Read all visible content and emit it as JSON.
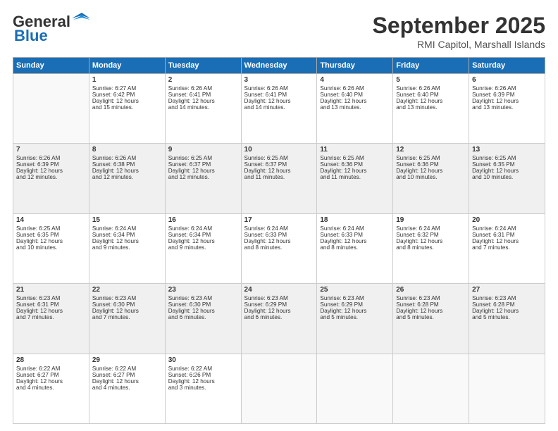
{
  "header": {
    "logo_line1": "General",
    "logo_line2": "Blue",
    "month": "September 2025",
    "location": "RMI Capitol, Marshall Islands"
  },
  "days_of_week": [
    "Sunday",
    "Monday",
    "Tuesday",
    "Wednesday",
    "Thursday",
    "Friday",
    "Saturday"
  ],
  "weeks": [
    [
      {
        "day": "",
        "lines": []
      },
      {
        "day": "1",
        "lines": [
          "Sunrise: 6:27 AM",
          "Sunset: 6:42 PM",
          "Daylight: 12 hours",
          "and 15 minutes."
        ]
      },
      {
        "day": "2",
        "lines": [
          "Sunrise: 6:26 AM",
          "Sunset: 6:41 PM",
          "Daylight: 12 hours",
          "and 14 minutes."
        ]
      },
      {
        "day": "3",
        "lines": [
          "Sunrise: 6:26 AM",
          "Sunset: 6:41 PM",
          "Daylight: 12 hours",
          "and 14 minutes."
        ]
      },
      {
        "day": "4",
        "lines": [
          "Sunrise: 6:26 AM",
          "Sunset: 6:40 PM",
          "Daylight: 12 hours",
          "and 13 minutes."
        ]
      },
      {
        "day": "5",
        "lines": [
          "Sunrise: 6:26 AM",
          "Sunset: 6:40 PM",
          "Daylight: 12 hours",
          "and 13 minutes."
        ]
      },
      {
        "day": "6",
        "lines": [
          "Sunrise: 6:26 AM",
          "Sunset: 6:39 PM",
          "Daylight: 12 hours",
          "and 13 minutes."
        ]
      }
    ],
    [
      {
        "day": "7",
        "lines": [
          "Sunrise: 6:26 AM",
          "Sunset: 6:39 PM",
          "Daylight: 12 hours",
          "and 12 minutes."
        ]
      },
      {
        "day": "8",
        "lines": [
          "Sunrise: 6:26 AM",
          "Sunset: 6:38 PM",
          "Daylight: 12 hours",
          "and 12 minutes."
        ]
      },
      {
        "day": "9",
        "lines": [
          "Sunrise: 6:25 AM",
          "Sunset: 6:37 PM",
          "Daylight: 12 hours",
          "and 12 minutes."
        ]
      },
      {
        "day": "10",
        "lines": [
          "Sunrise: 6:25 AM",
          "Sunset: 6:37 PM",
          "Daylight: 12 hours",
          "and 11 minutes."
        ]
      },
      {
        "day": "11",
        "lines": [
          "Sunrise: 6:25 AM",
          "Sunset: 6:36 PM",
          "Daylight: 12 hours",
          "and 11 minutes."
        ]
      },
      {
        "day": "12",
        "lines": [
          "Sunrise: 6:25 AM",
          "Sunset: 6:36 PM",
          "Daylight: 12 hours",
          "and 10 minutes."
        ]
      },
      {
        "day": "13",
        "lines": [
          "Sunrise: 6:25 AM",
          "Sunset: 6:35 PM",
          "Daylight: 12 hours",
          "and 10 minutes."
        ]
      }
    ],
    [
      {
        "day": "14",
        "lines": [
          "Sunrise: 6:25 AM",
          "Sunset: 6:35 PM",
          "Daylight: 12 hours",
          "and 10 minutes."
        ]
      },
      {
        "day": "15",
        "lines": [
          "Sunrise: 6:24 AM",
          "Sunset: 6:34 PM",
          "Daylight: 12 hours",
          "and 9 minutes."
        ]
      },
      {
        "day": "16",
        "lines": [
          "Sunrise: 6:24 AM",
          "Sunset: 6:34 PM",
          "Daylight: 12 hours",
          "and 9 minutes."
        ]
      },
      {
        "day": "17",
        "lines": [
          "Sunrise: 6:24 AM",
          "Sunset: 6:33 PM",
          "Daylight: 12 hours",
          "and 8 minutes."
        ]
      },
      {
        "day": "18",
        "lines": [
          "Sunrise: 6:24 AM",
          "Sunset: 6:33 PM",
          "Daylight: 12 hours",
          "and 8 minutes."
        ]
      },
      {
        "day": "19",
        "lines": [
          "Sunrise: 6:24 AM",
          "Sunset: 6:32 PM",
          "Daylight: 12 hours",
          "and 8 minutes."
        ]
      },
      {
        "day": "20",
        "lines": [
          "Sunrise: 6:24 AM",
          "Sunset: 6:31 PM",
          "Daylight: 12 hours",
          "and 7 minutes."
        ]
      }
    ],
    [
      {
        "day": "21",
        "lines": [
          "Sunrise: 6:23 AM",
          "Sunset: 6:31 PM",
          "Daylight: 12 hours",
          "and 7 minutes."
        ]
      },
      {
        "day": "22",
        "lines": [
          "Sunrise: 6:23 AM",
          "Sunset: 6:30 PM",
          "Daylight: 12 hours",
          "and 7 minutes."
        ]
      },
      {
        "day": "23",
        "lines": [
          "Sunrise: 6:23 AM",
          "Sunset: 6:30 PM",
          "Daylight: 12 hours",
          "and 6 minutes."
        ]
      },
      {
        "day": "24",
        "lines": [
          "Sunrise: 6:23 AM",
          "Sunset: 6:29 PM",
          "Daylight: 12 hours",
          "and 6 minutes."
        ]
      },
      {
        "day": "25",
        "lines": [
          "Sunrise: 6:23 AM",
          "Sunset: 6:29 PM",
          "Daylight: 12 hours",
          "and 5 minutes."
        ]
      },
      {
        "day": "26",
        "lines": [
          "Sunrise: 6:23 AM",
          "Sunset: 6:28 PM",
          "Daylight: 12 hours",
          "and 5 minutes."
        ]
      },
      {
        "day": "27",
        "lines": [
          "Sunrise: 6:23 AM",
          "Sunset: 6:28 PM",
          "Daylight: 12 hours",
          "and 5 minutes."
        ]
      }
    ],
    [
      {
        "day": "28",
        "lines": [
          "Sunrise: 6:22 AM",
          "Sunset: 6:27 PM",
          "Daylight: 12 hours",
          "and 4 minutes."
        ]
      },
      {
        "day": "29",
        "lines": [
          "Sunrise: 6:22 AM",
          "Sunset: 6:27 PM",
          "Daylight: 12 hours",
          "and 4 minutes."
        ]
      },
      {
        "day": "30",
        "lines": [
          "Sunrise: 6:22 AM",
          "Sunset: 6:26 PM",
          "Daylight: 12 hours",
          "and 3 minutes."
        ]
      },
      {
        "day": "",
        "lines": []
      },
      {
        "day": "",
        "lines": []
      },
      {
        "day": "",
        "lines": []
      },
      {
        "day": "",
        "lines": []
      }
    ]
  ]
}
